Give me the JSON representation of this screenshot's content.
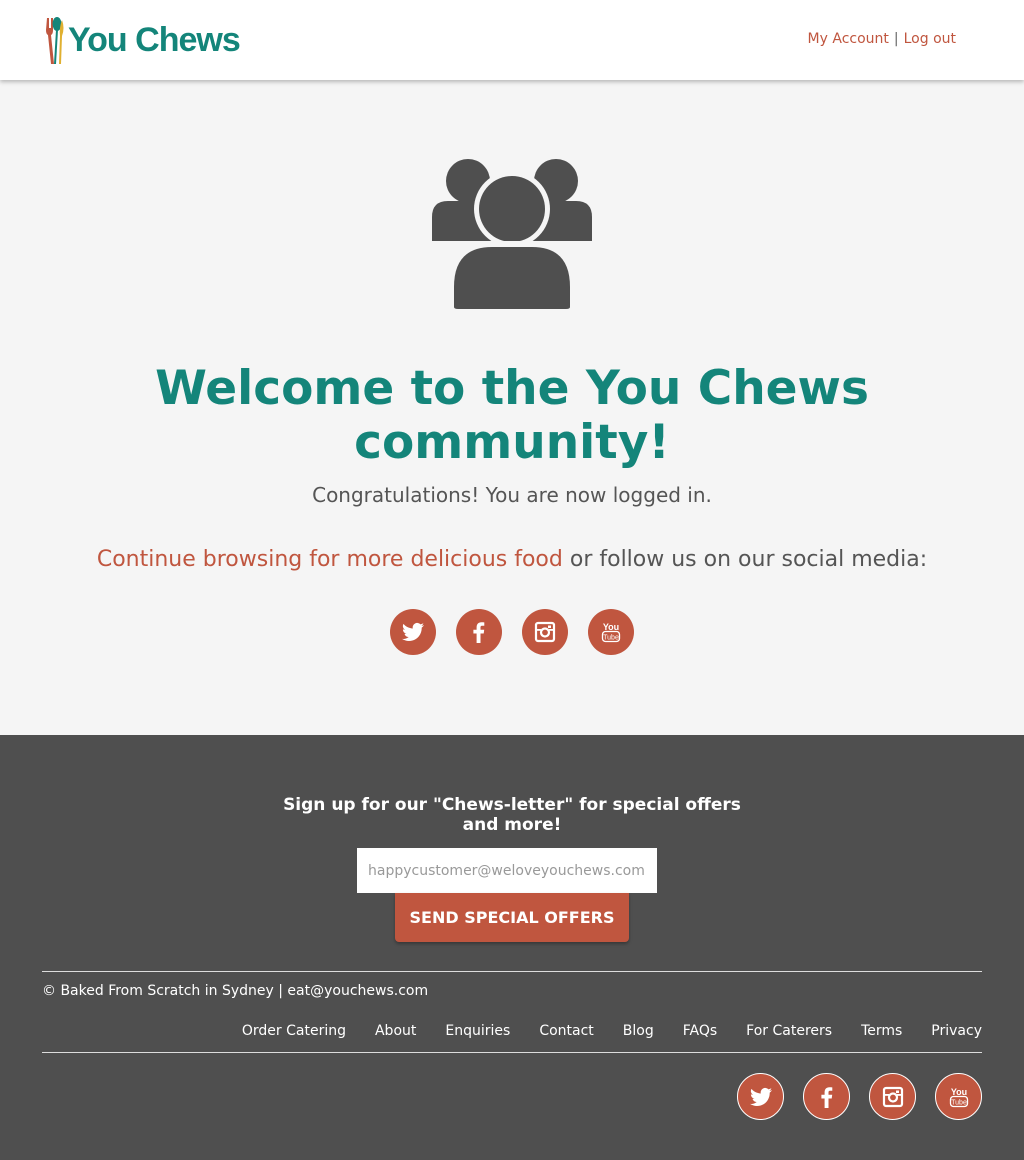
{
  "header": {
    "logo_text": "You Chews",
    "my_account": "My Account",
    "separator": "|",
    "logout": "Log out"
  },
  "main": {
    "icon": "community-users-icon",
    "title": "Welcome to the You Chews community!",
    "subtitle": "Congratulations! You are now logged in.",
    "continue_link": "Continue browsing for more delicious food",
    "continue_rest": " or follow us on our social media:",
    "social": [
      "twitter-icon",
      "facebook-icon",
      "instagram-icon",
      "youtube-icon"
    ]
  },
  "footer": {
    "newsletter_title": "Sign up for our \"Chews-letter\" for special offers and more!",
    "email_placeholder": "happycustomer@weloveyouchews.com",
    "send_button": "SEND SPECIAL OFFERS",
    "copyright": "© Baked From Scratch in Sydney | eat@youchews.com",
    "nav": [
      "Order Catering",
      "About",
      "Enquiries",
      "Contact",
      "Blog",
      "FAQs",
      "For Caterers",
      "Terms",
      "Privacy"
    ]
  },
  "colors": {
    "brand_teal": "#14857a",
    "accent_red": "#c0563f",
    "footer_bg": "#4f4f4f",
    "main_bg": "#f5f5f5"
  }
}
